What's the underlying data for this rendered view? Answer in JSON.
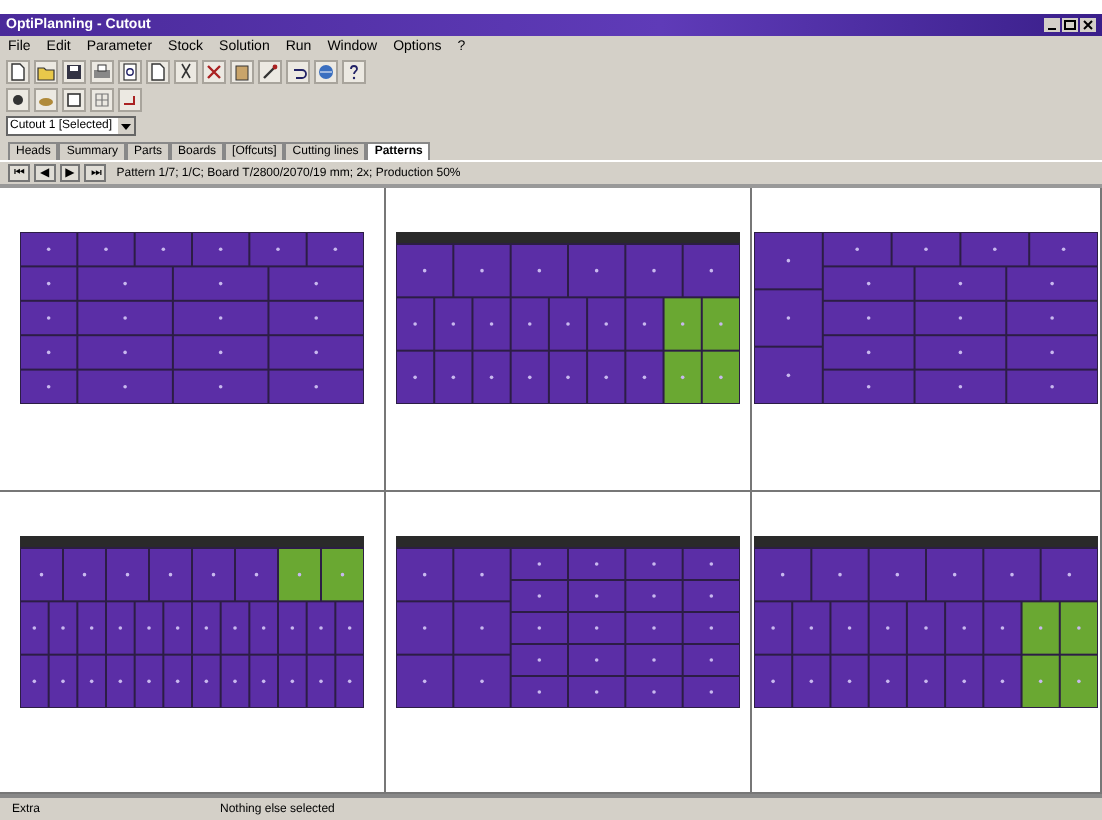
{
  "window": {
    "title": "OptiPlanning - Cutout"
  },
  "menu": [
    "File",
    "Edit",
    "Parameter",
    "Stock",
    "Solution",
    "Run",
    "Window",
    "Options",
    "?"
  ],
  "combo": {
    "value": "Cutout 1 [Selected]"
  },
  "tabs": [
    {
      "label": "Heads",
      "selected": false
    },
    {
      "label": "Summary",
      "selected": false
    },
    {
      "label": "Parts",
      "selected": false
    },
    {
      "label": "Boards",
      "selected": false
    },
    {
      "label": "[Offcuts]",
      "selected": false
    },
    {
      "label": "Cutting lines",
      "selected": false
    },
    {
      "label": "Patterns",
      "selected": true
    }
  ],
  "nav": [
    "⏮",
    "◀",
    "▶",
    "⏭"
  ],
  "pattern_info": "Pattern 1/7; 1/C; Board T/2800/2070/19 mm; 2x; Production 50%",
  "patterns": [
    {
      "trim": false,
      "groups": [
        {
          "rows": [
            {
              "pieces": [
                {
                  "color": "#5b2ea6"
                }
              ]
            },
            {
              "pieces": [
                {
                  "color": "#5b2ea6"
                }
              ]
            },
            {
              "pieces": [
                {
                  "color": "#5b2ea6"
                }
              ]
            },
            {
              "pieces": [
                {
                  "color": "#5b2ea6"
                }
              ]
            },
            {
              "pieces": [
                {
                  "color": "#5b2ea6"
                }
              ]
            }
          ]
        },
        {
          "rows": [
            {
              "pieces": [
                {
                  "color": "#5b2ea6"
                },
                {
                  "color": "#5b2ea6"
                },
                {
                  "color": "#5b2ea6"
                },
                {
                  "color": "#5b2ea6"
                },
                {
                  "color": "#5b2ea6"
                }
              ]
            },
            {
              "pieces": [
                {
                  "color": "#5b2ea6"
                },
                {
                  "color": "#5b2ea6"
                },
                {
                  "color": "#5b2ea6"
                }
              ]
            },
            {
              "pieces": [
                {
                  "color": "#5b2ea6"
                },
                {
                  "color": "#5b2ea6"
                },
                {
                  "color": "#5b2ea6"
                }
              ]
            },
            {
              "pieces": [
                {
                  "color": "#5b2ea6"
                },
                {
                  "color": "#5b2ea6"
                },
                {
                  "color": "#5b2ea6"
                }
              ]
            },
            {
              "pieces": [
                {
                  "color": "#5b2ea6"
                },
                {
                  "color": "#5b2ea6"
                },
                {
                  "color": "#5b2ea6"
                }
              ]
            }
          ]
        }
      ]
    },
    {
      "trim": true,
      "groups": [
        {
          "rows": [
            {
              "pieces": [
                {
                  "color": "#5b2ea6"
                },
                {
                  "color": "#5b2ea6"
                },
                {
                  "color": "#5b2ea6"
                },
                {
                  "color": "#5b2ea6"
                },
                {
                  "color": "#5b2ea6"
                },
                {
                  "color": "#5b2ea6"
                }
              ]
            },
            {
              "pieces": [
                {
                  "color": "#5b2ea6"
                },
                {
                  "color": "#5b2ea6"
                },
                {
                  "color": "#5b2ea6"
                },
                {
                  "color": "#5b2ea6"
                },
                {
                  "color": "#5b2ea6"
                },
                {
                  "color": "#5b2ea6"
                },
                {
                  "color": "#5b2ea6"
                },
                {
                  "color": "#6aa832"
                },
                {
                  "color": "#6aa832"
                }
              ]
            },
            {
              "pieces": [
                {
                  "color": "#5b2ea6"
                },
                {
                  "color": "#5b2ea6"
                },
                {
                  "color": "#5b2ea6"
                },
                {
                  "color": "#5b2ea6"
                },
                {
                  "color": "#5b2ea6"
                },
                {
                  "color": "#5b2ea6"
                },
                {
                  "color": "#5b2ea6"
                },
                {
                  "color": "#6aa832"
                },
                {
                  "color": "#6aa832"
                }
              ]
            }
          ]
        }
      ]
    },
    {
      "trim": false,
      "groups": [
        {
          "rows": [
            {
              "pieces": [
                {
                  "color": "#5b2ea6"
                }
              ]
            },
            {
              "pieces": [
                {
                  "color": "#5b2ea6"
                }
              ]
            },
            {
              "pieces": [
                {
                  "color": "#5b2ea6"
                }
              ]
            }
          ]
        },
        {
          "rows": [
            {
              "pieces": [
                {
                  "color": "#5b2ea6"
                },
                {
                  "color": "#5b2ea6"
                },
                {
                  "color": "#5b2ea6"
                },
                {
                  "color": "#5b2ea6"
                }
              ]
            },
            {
              "pieces": [
                {
                  "color": "#5b2ea6"
                },
                {
                  "color": "#5b2ea6"
                },
                {
                  "color": "#5b2ea6"
                }
              ]
            },
            {
              "pieces": [
                {
                  "color": "#5b2ea6"
                },
                {
                  "color": "#5b2ea6"
                },
                {
                  "color": "#5b2ea6"
                }
              ]
            },
            {
              "pieces": [
                {
                  "color": "#5b2ea6"
                },
                {
                  "color": "#5b2ea6"
                },
                {
                  "color": "#5b2ea6"
                }
              ]
            },
            {
              "pieces": [
                {
                  "color": "#5b2ea6"
                },
                {
                  "color": "#5b2ea6"
                },
                {
                  "color": "#5b2ea6"
                }
              ]
            }
          ]
        }
      ]
    },
    {
      "trim": true,
      "groups": [
        {
          "rows": [
            {
              "pieces": [
                {
                  "color": "#5b2ea6"
                },
                {
                  "color": "#5b2ea6"
                },
                {
                  "color": "#5b2ea6"
                },
                {
                  "color": "#5b2ea6"
                },
                {
                  "color": "#5b2ea6"
                },
                {
                  "color": "#5b2ea6"
                },
                {
                  "color": "#6aa832"
                },
                {
                  "color": "#6aa832"
                }
              ]
            },
            {
              "pieces": [
                {
                  "color": "#5b2ea6"
                },
                {
                  "color": "#5b2ea6"
                },
                {
                  "color": "#5b2ea6"
                },
                {
                  "color": "#5b2ea6"
                },
                {
                  "color": "#5b2ea6"
                },
                {
                  "color": "#5b2ea6"
                },
                {
                  "color": "#5b2ea6"
                },
                {
                  "color": "#5b2ea6"
                },
                {
                  "color": "#5b2ea6"
                },
                {
                  "color": "#5b2ea6"
                },
                {
                  "color": "#5b2ea6"
                },
                {
                  "color": "#5b2ea6"
                }
              ]
            },
            {
              "pieces": [
                {
                  "color": "#5b2ea6"
                },
                {
                  "color": "#5b2ea6"
                },
                {
                  "color": "#5b2ea6"
                },
                {
                  "color": "#5b2ea6"
                },
                {
                  "color": "#5b2ea6"
                },
                {
                  "color": "#5b2ea6"
                },
                {
                  "color": "#5b2ea6"
                },
                {
                  "color": "#5b2ea6"
                },
                {
                  "color": "#5b2ea6"
                },
                {
                  "color": "#5b2ea6"
                },
                {
                  "color": "#5b2ea6"
                },
                {
                  "color": "#5b2ea6"
                }
              ]
            }
          ]
        }
      ]
    },
    {
      "trim": true,
      "groups": [
        {
          "rows": [
            {
              "pieces": [
                {
                  "color": "#5b2ea6"
                },
                {
                  "color": "#5b2ea6"
                }
              ]
            },
            {
              "pieces": [
                {
                  "color": "#5b2ea6"
                },
                {
                  "color": "#5b2ea6"
                }
              ]
            },
            {
              "pieces": [
                {
                  "color": "#5b2ea6"
                },
                {
                  "color": "#5b2ea6"
                }
              ]
            }
          ]
        },
        {
          "rows": [
            {
              "pieces": [
                {
                  "color": "#5b2ea6"
                },
                {
                  "color": "#5b2ea6"
                },
                {
                  "color": "#5b2ea6"
                },
                {
                  "color": "#5b2ea6"
                }
              ]
            },
            {
              "pieces": [
                {
                  "color": "#5b2ea6"
                },
                {
                  "color": "#5b2ea6"
                },
                {
                  "color": "#5b2ea6"
                },
                {
                  "color": "#5b2ea6"
                }
              ]
            },
            {
              "pieces": [
                {
                  "color": "#5b2ea6"
                },
                {
                  "color": "#5b2ea6"
                },
                {
                  "color": "#5b2ea6"
                },
                {
                  "color": "#5b2ea6"
                }
              ]
            },
            {
              "pieces": [
                {
                  "color": "#5b2ea6"
                },
                {
                  "color": "#5b2ea6"
                },
                {
                  "color": "#5b2ea6"
                },
                {
                  "color": "#5b2ea6"
                }
              ]
            },
            {
              "pieces": [
                {
                  "color": "#5b2ea6"
                },
                {
                  "color": "#5b2ea6"
                },
                {
                  "color": "#5b2ea6"
                },
                {
                  "color": "#5b2ea6"
                }
              ]
            }
          ]
        }
      ]
    },
    {
      "trim": true,
      "groups": [
        {
          "rows": [
            {
              "pieces": [
                {
                  "color": "#5b2ea6"
                },
                {
                  "color": "#5b2ea6"
                },
                {
                  "color": "#5b2ea6"
                },
                {
                  "color": "#5b2ea6"
                },
                {
                  "color": "#5b2ea6"
                },
                {
                  "color": "#5b2ea6"
                }
              ]
            },
            {
              "pieces": [
                {
                  "color": "#5b2ea6"
                },
                {
                  "color": "#5b2ea6"
                },
                {
                  "color": "#5b2ea6"
                },
                {
                  "color": "#5b2ea6"
                },
                {
                  "color": "#5b2ea6"
                },
                {
                  "color": "#5b2ea6"
                },
                {
                  "color": "#5b2ea6"
                },
                {
                  "color": "#6aa832"
                },
                {
                  "color": "#6aa832"
                }
              ]
            },
            {
              "pieces": [
                {
                  "color": "#5b2ea6"
                },
                {
                  "color": "#5b2ea6"
                },
                {
                  "color": "#5b2ea6"
                },
                {
                  "color": "#5b2ea6"
                },
                {
                  "color": "#5b2ea6"
                },
                {
                  "color": "#5b2ea6"
                },
                {
                  "color": "#5b2ea6"
                },
                {
                  "color": "#6aa832"
                },
                {
                  "color": "#6aa832"
                }
              ]
            }
          ]
        }
      ]
    }
  ],
  "status_bar": [
    "Extra",
    "Nothing else selected"
  ]
}
